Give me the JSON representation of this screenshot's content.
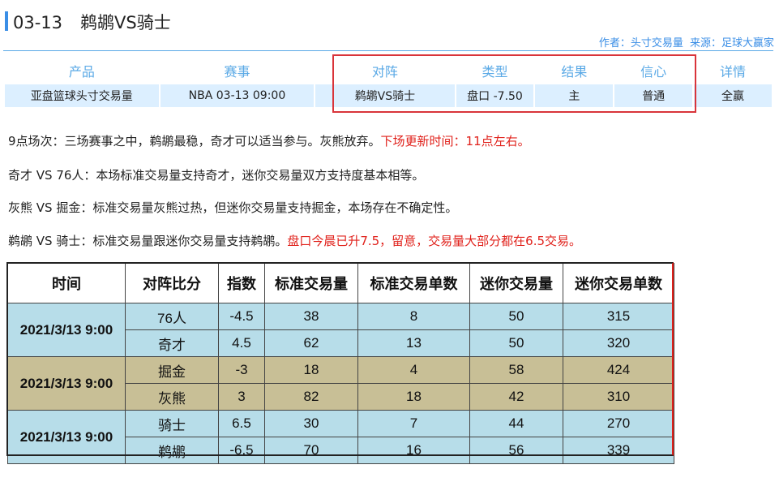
{
  "header": {
    "date": "03-13",
    "matchup": "鹈鹕VS骑士",
    "author_label": "作者：头寸交易量",
    "source_label": "来源：足球大赢家"
  },
  "summary": {
    "headers": [
      "产品",
      "赛事",
      "对阵",
      "类型",
      "结果",
      "信心",
      "详情"
    ],
    "row": [
      "亚盘篮球头寸交易量",
      "NBA 03-13 09:00",
      "鹈鹕VS骑士",
      "盘口 -7.50",
      "主",
      "普通",
      "全赢"
    ]
  },
  "paragraphs": [
    {
      "text": "9点场次：三场赛事之中，鹈鹕最稳，奇才可以适当参与。灰熊放弃。",
      "red": "下场更新时间：11点左右。"
    },
    {
      "text": "奇才 VS 76人：本场标准交易量支持奇才，迷你交易量双方支持度基本相等。",
      "red": ""
    },
    {
      "text": "灰熊 VS 掘金：标准交易量灰熊过热，但迷你交易量支持掘金，本场存在不确定性。",
      "red": ""
    },
    {
      "text": "鹈鹕 VS 骑士：标准交易量跟迷你交易量支持鹈鹕。",
      "red": "盘口今晨已升7.5，留意，交易量大部分都在6.5交易。"
    }
  ],
  "table": {
    "headers": [
      "时间",
      "对阵比分",
      "指数",
      "标准交易量",
      "标准交易单数",
      "迷你交易量",
      "迷你交易单数"
    ],
    "groups": [
      {
        "time": "2021/3/13 9:00",
        "rows": [
          [
            "76人",
            "-4.5",
            "38",
            "8",
            "50",
            "315"
          ],
          [
            "奇才",
            "4.5",
            "62",
            "13",
            "50",
            "320"
          ]
        ]
      },
      {
        "time": "2021/3/13 9:00",
        "rows": [
          [
            "掘金",
            "-3",
            "18",
            "4",
            "58",
            "424"
          ],
          [
            "灰熊",
            "3",
            "82",
            "18",
            "42",
            "310"
          ]
        ]
      },
      {
        "time": "2021/3/13 9:00",
        "rows": [
          [
            "骑士",
            "6.5",
            "30",
            "7",
            "44",
            "270"
          ],
          [
            "鹈鹕",
            "-6.5",
            "70",
            "16",
            "56",
            "339"
          ]
        ]
      }
    ]
  },
  "colors": {
    "accent": "#3a8ee6",
    "highlight": "#d9343a",
    "red_text": "#e0201a",
    "group_blue": "#b7dde9",
    "group_tan": "#c8bf96"
  }
}
